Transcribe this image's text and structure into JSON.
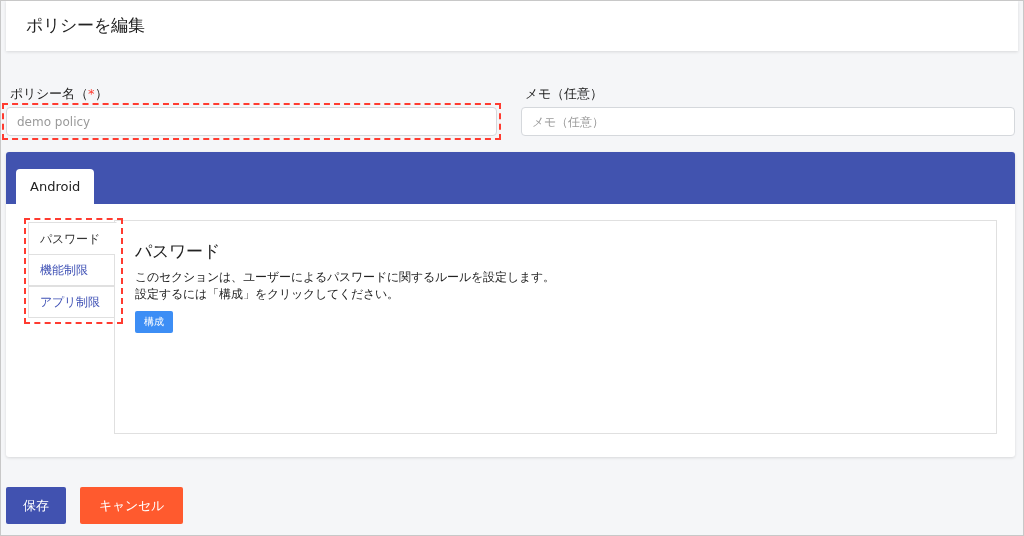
{
  "page_title": "ポリシーを編集",
  "fields": [
    {
      "label": "ポリシー名（",
      "required_mark": "*",
      "label_suffix": "）",
      "placeholder": "demo policy",
      "highlighted": true
    },
    {
      "label": "メモ（任意）",
      "placeholder": "メモ（任意）",
      "highlighted": false
    }
  ],
  "platform_tabs": [
    {
      "label": "Android",
      "selected": true
    }
  ],
  "section_tabs": {
    "highlighted": true,
    "items": [
      {
        "label": "パスワード",
        "selected": true
      },
      {
        "label": "機能制限",
        "selected": false
      },
      {
        "label": "アプリ制限",
        "selected": false
      }
    ]
  },
  "section": {
    "title": "パスワード",
    "description": [
      "このセクションは、ユーザーによるパスワードに関するルールを設定します。",
      "設定するには「構成」をクリックしてください。"
    ],
    "button": "構成"
  },
  "actions": [
    {
      "label": "保存",
      "kind": "primary"
    },
    {
      "label": "キャンセル",
      "kind": "danger"
    }
  ]
}
